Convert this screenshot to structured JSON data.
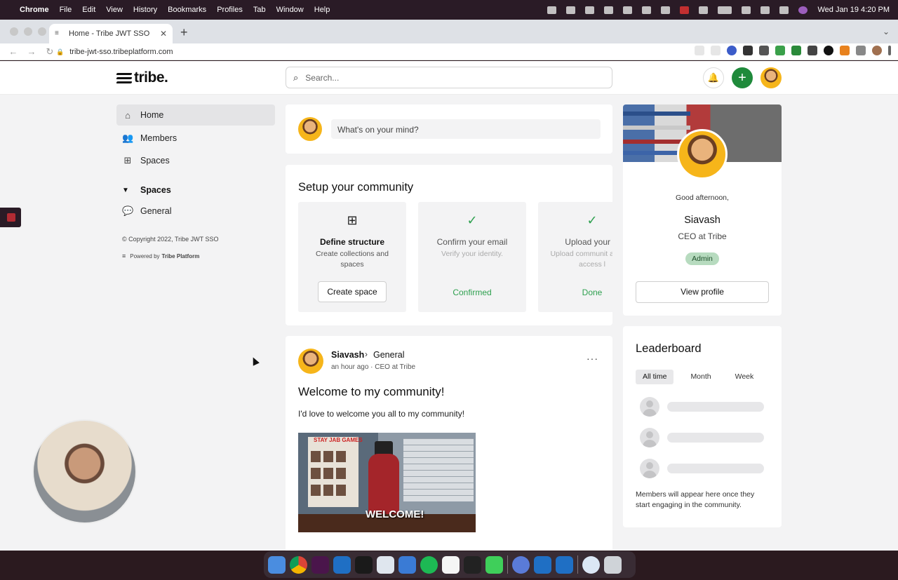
{
  "menubar": {
    "app": "Chrome",
    "items": [
      "File",
      "Edit",
      "View",
      "History",
      "Bookmarks",
      "Profiles",
      "Tab",
      "Window",
      "Help"
    ],
    "clock": "Wed Jan 19  4:20 PM"
  },
  "browser": {
    "tab_title": "Home - Tribe JWT SSO",
    "url": "tribe-jwt-sso.tribeplatform.com"
  },
  "header": {
    "logo": "tribe.",
    "search_placeholder": "Search..."
  },
  "sidebar": {
    "items": [
      {
        "label": "Home",
        "icon": "home-icon"
      },
      {
        "label": "Members",
        "icon": "members-icon"
      },
      {
        "label": "Spaces",
        "icon": "spaces-icon"
      }
    ],
    "section_title": "Spaces",
    "section_items": [
      {
        "label": "General",
        "icon": "chat-bubble-icon"
      }
    ],
    "copyright": "© Copyright 2022, Tribe JWT SSO",
    "powered_by": "Powered by",
    "powered_brand": "Tribe Platform"
  },
  "composer": {
    "placeholder": "What's on your mind?"
  },
  "setup": {
    "title": "Setup your community",
    "steps": [
      {
        "title": "Define structure",
        "desc": "Create collections and spaces",
        "action": "Create space"
      },
      {
        "title": "Confirm your email",
        "desc": "Verify your identity.",
        "status": "Confirmed"
      },
      {
        "title": "Upload your lo",
        "desc": "Upload communit and set access l",
        "status": "Done"
      }
    ]
  },
  "post": {
    "author": "Siavash",
    "space": "General",
    "meta": "an hour ago · CEO at Tribe",
    "title": "Welcome to my community!",
    "body": "I'd love to welcome you all to my community!",
    "gif_caption": "WELCOME!",
    "gif_sign": "STAY JAB GAMES"
  },
  "profile": {
    "greeting": "Good afternoon,",
    "name": "Siavash",
    "role": "CEO at Tribe",
    "badge": "Admin",
    "button": "View profile"
  },
  "leaderboard": {
    "title": "Leaderboard",
    "tabs": [
      "All time",
      "Month",
      "Week"
    ],
    "note": "Members will appear here once they start engaging in the community."
  },
  "colors": {
    "accent_green": "#1f8a3b",
    "check_green": "#2ea04f",
    "admin_badge": "#b7dbbf"
  }
}
